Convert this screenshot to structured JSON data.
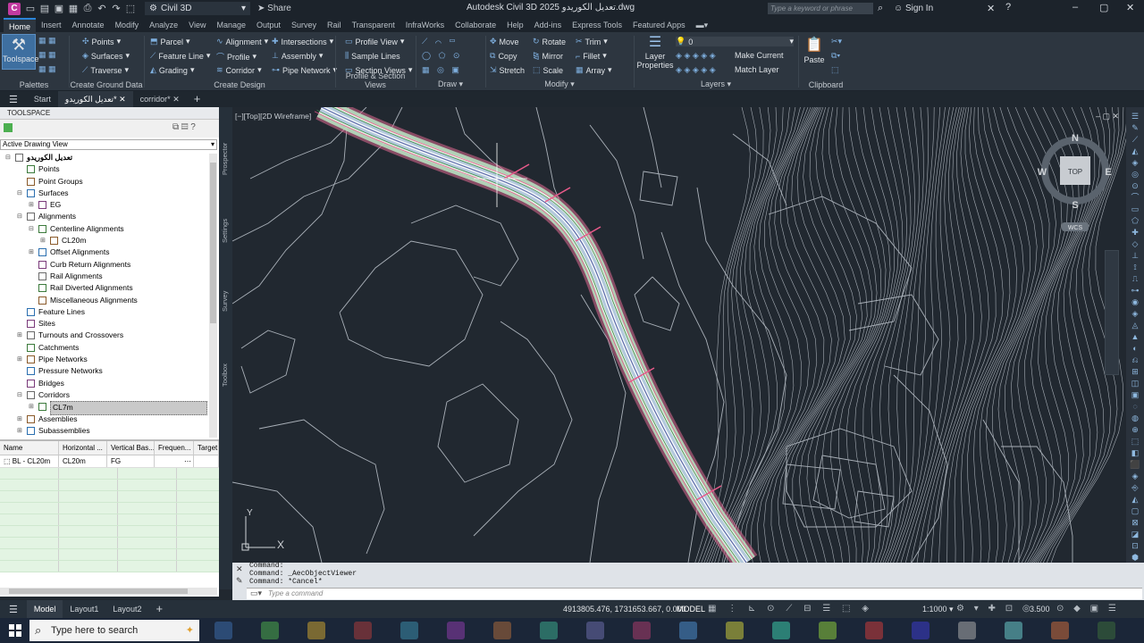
{
  "titlebar": {
    "app_icon": "C",
    "workspace": "Civil 3D",
    "share": "Share",
    "title": "Autodesk Civil 3D 2025  تعديل الكوريدو.dwg",
    "search_placeholder": "Type a keyword or phrase",
    "signin": "Sign In"
  },
  "ribbon_tabs": [
    "Home",
    "Insert",
    "Annotate",
    "Modify",
    "Analyze",
    "View",
    "Manage",
    "Output",
    "Survey",
    "Rail",
    "Transparent",
    "InfraWorks",
    "Collaborate",
    "Help",
    "Add-ins",
    "Express Tools",
    "Featured Apps"
  ],
  "ribbon": {
    "toolspace": "Toolspace",
    "palettes": "Palettes",
    "ground": {
      "points": "Points",
      "surfaces": "Surfaces",
      "traverse": "Traverse",
      "label": "Create Ground Data"
    },
    "design": {
      "parcel": "Parcel",
      "feature_line": "Feature Line",
      "grading": "Grading",
      "alignment": "Alignment",
      "profile": "Profile",
      "corridor": "Corridor",
      "intersections": "Intersections",
      "assembly": "Assembly",
      "pipe_network": "Pipe Network",
      "label": "Create Design"
    },
    "profile": {
      "profile_view": "Profile View",
      "sample_lines": "Sample Lines",
      "section_views": "Section Views",
      "label": "Profile & Section Views"
    },
    "draw": {
      "label": "Draw"
    },
    "modify": {
      "move": "Move",
      "copy": "Copy",
      "stretch": "Stretch",
      "rotate": "Rotate",
      "mirror": "Mirror",
      "scale": "Scale",
      "trim": "Trim",
      "fillet": "Fillet",
      "array": "Array",
      "label": "Modify"
    },
    "layers": {
      "layer_properties": "Layer Properties",
      "current_layer": "0",
      "make_current": "Make Current",
      "match_layer": "Match Layer",
      "label": "Layers"
    },
    "clipboard": {
      "paste": "Paste",
      "label": "Clipboard"
    }
  },
  "file_tabs": [
    {
      "label": "Start"
    },
    {
      "label": "تعديل الكوريدو*"
    },
    {
      "label": "corridor*"
    }
  ],
  "toolspace": {
    "header": "TOOLSPACE",
    "view": "Active Drawing View",
    "tree": [
      {
        "label": "تعديل الكوريدو",
        "level": 0,
        "box": "⊟",
        "bold": true
      },
      {
        "label": "Points",
        "level": 1,
        "box": ""
      },
      {
        "label": "Point Groups",
        "level": 1,
        "box": ""
      },
      {
        "label": "Surfaces",
        "level": 1,
        "box": "⊟"
      },
      {
        "label": "EG",
        "level": 2,
        "box": "⊞"
      },
      {
        "label": "Alignments",
        "level": 1,
        "box": "⊟"
      },
      {
        "label": "Centerline Alignments",
        "level": 2,
        "box": "⊟"
      },
      {
        "label": "CL20m",
        "level": 3,
        "box": "⊞"
      },
      {
        "label": "Offset Alignments",
        "level": 2,
        "box": "⊞"
      },
      {
        "label": "Curb Return Alignments",
        "level": 2,
        "box": ""
      },
      {
        "label": "Rail Alignments",
        "level": 2,
        "box": ""
      },
      {
        "label": "Rail Diverted Alignments",
        "level": 2,
        "box": ""
      },
      {
        "label": "Miscellaneous Alignments",
        "level": 2,
        "box": ""
      },
      {
        "label": "Feature Lines",
        "level": 1,
        "box": ""
      },
      {
        "label": "Sites",
        "level": 1,
        "box": ""
      },
      {
        "label": "Turnouts and Crossovers",
        "level": 1,
        "box": "⊞"
      },
      {
        "label": "Catchments",
        "level": 1,
        "box": ""
      },
      {
        "label": "Pipe Networks",
        "level": 1,
        "box": "⊞"
      },
      {
        "label": "Pressure Networks",
        "level": 1,
        "box": ""
      },
      {
        "label": "Bridges",
        "level": 1,
        "box": ""
      },
      {
        "label": "Corridors",
        "level": 1,
        "box": "⊟"
      },
      {
        "label": "CL7m",
        "level": 2,
        "box": "⊞",
        "selected": true
      },
      {
        "label": "Assemblies",
        "level": 1,
        "box": "⊞"
      },
      {
        "label": "Subassemblies",
        "level": 1,
        "box": "⊞"
      }
    ]
  },
  "side_tabs": [
    "Prospector",
    "Settings",
    "Survey",
    "Toolbox"
  ],
  "grid": {
    "columns": [
      "Name",
      "Horizontal ...",
      "Vertical Bas...",
      "Frequen...",
      "Target"
    ],
    "row": [
      "BL - CL20m",
      "CL20m",
      "FG",
      "",
      ""
    ]
  },
  "viewport": {
    "label": "[−][Top][2D Wireframe]",
    "viewcube": {
      "n": "N",
      "s": "S",
      "e": "E",
      "w": "W",
      "top": "TOP",
      "wcs": "WCS"
    },
    "ucs": {
      "x": "X",
      "y": "Y"
    }
  },
  "command": {
    "lines": [
      "Command:",
      "Command: _AecObjectViewer",
      "Command: *Cancel*"
    ],
    "placeholder": "Type a command"
  },
  "status": {
    "tabs": [
      "Model",
      "Layout1",
      "Layout2"
    ],
    "coords": "4913805.476, 1731653.667, 0.000",
    "model": "MODEL",
    "scale": "1:1000",
    "value": "3.500"
  },
  "taskbar": {
    "search": "Type here to search"
  },
  "colors": {
    "accent": "#2b84d8",
    "ribbon": "#2d3640",
    "viewport": "#212830",
    "contour": "#a9b0b8",
    "corridor": "#e85a8a"
  }
}
